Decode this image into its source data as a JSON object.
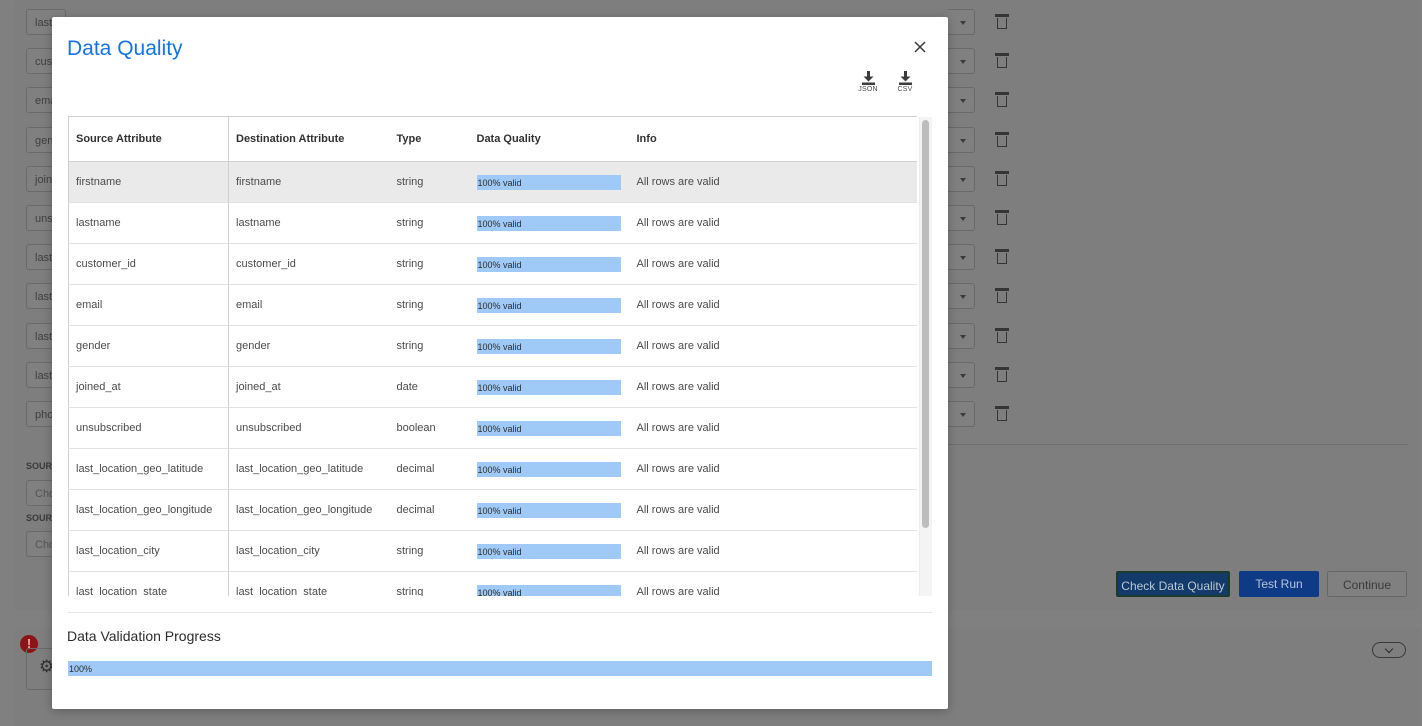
{
  "background": {
    "rows": [
      "last",
      "cus",
      "ema",
      "gen",
      "join",
      "uns",
      "last",
      "last",
      "last",
      "last",
      "pho"
    ],
    "source_labels": [
      "SOUR",
      "SOUR"
    ],
    "source_placeholders": [
      "Cho",
      "Cho"
    ],
    "buttons": {
      "check_data_quality": "Check Data Quality",
      "test_run": "Test Run",
      "continue": "Continue"
    },
    "alert_symbol": "!"
  },
  "modal": {
    "title": "Data Quality",
    "downloads": [
      {
        "label": "JSON",
        "icon": "download-icon"
      },
      {
        "label": "CSV",
        "icon": "download-icon"
      }
    ],
    "table": {
      "headers": [
        "Source Attribute",
        "Destination Attribute",
        "Type",
        "Data Quality",
        "Info"
      ],
      "rows": [
        {
          "source": "firstname",
          "destination": "firstname",
          "type": "string",
          "quality_label": "100% valid",
          "quality": 1.0,
          "info": "All rows are valid"
        },
        {
          "source": "lastname",
          "destination": "lastname",
          "type": "string",
          "quality_label": "100% valid",
          "quality": 1.0,
          "info": "All rows are valid"
        },
        {
          "source": "customer_id",
          "destination": "customer_id",
          "type": "string",
          "quality_label": "100% valid",
          "quality": 1.0,
          "info": "All rows are valid"
        },
        {
          "source": "email",
          "destination": "email",
          "type": "string",
          "quality_label": "100% valid",
          "quality": 1.0,
          "info": "All rows are valid"
        },
        {
          "source": "gender",
          "destination": "gender",
          "type": "string",
          "quality_label": "100% valid",
          "quality": 1.0,
          "info": "All rows are valid"
        },
        {
          "source": "joined_at",
          "destination": "joined_at",
          "type": "date",
          "quality_label": "100% valid",
          "quality": 1.0,
          "info": "All rows are valid"
        },
        {
          "source": "unsubscribed",
          "destination": "unsubscribed",
          "type": "boolean",
          "quality_label": "100% valid",
          "quality": 1.0,
          "info": "All rows are valid"
        },
        {
          "source": "last_location_geo_latitude",
          "destination": "last_location_geo_latitude",
          "type": "decimal",
          "quality_label": "100% valid",
          "quality": 1.0,
          "info": "All rows are valid"
        },
        {
          "source": "last_location_geo_longitude",
          "destination": "last_location_geo_longitude",
          "type": "decimal",
          "quality_label": "100% valid",
          "quality": 1.0,
          "info": "All rows are valid"
        },
        {
          "source": "last_location_city",
          "destination": "last_location_city",
          "type": "string",
          "quality_label": "100% valid",
          "quality": 1.0,
          "info": "All rows are valid"
        },
        {
          "source": "last_location_state",
          "destination": "last_location_state",
          "type": "string",
          "quality_label": "100% valid",
          "quality": 1.0,
          "info": "All rows are valid"
        }
      ]
    },
    "progress": {
      "title": "Data Validation Progress",
      "label": "100%",
      "value": 1.0
    }
  },
  "colors": {
    "accent": "#1473e6",
    "quality_bar": "#9fcaf8",
    "primary_button": "#0f3a85",
    "alert": "#8c1416"
  }
}
